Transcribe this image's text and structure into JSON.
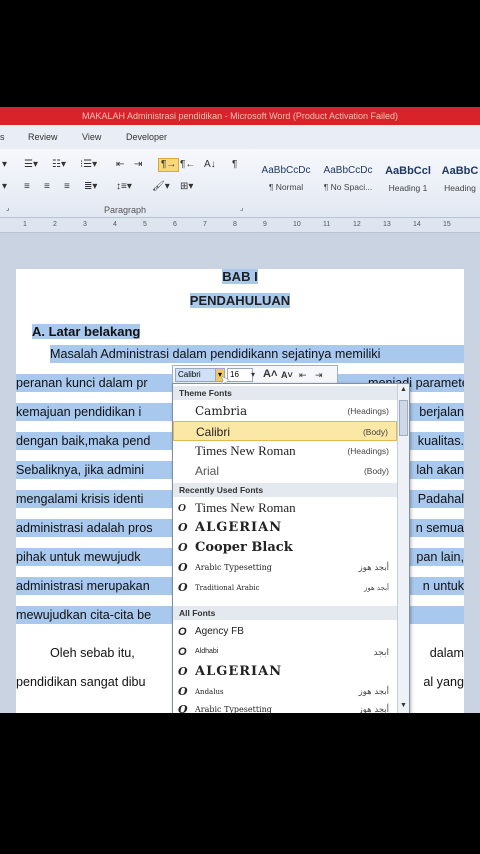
{
  "window": {
    "title": "MAKALAH Administrasi pendidikan - Microsoft Word (Product Activation Failed)"
  },
  "menu": [
    "Review",
    "View",
    "Developer"
  ],
  "ribbon": {
    "paragraph_label": "Paragraph",
    "styles": [
      {
        "preview": "AaBbCcDc",
        "name": "¶ Normal"
      },
      {
        "preview": "AaBbCcDc",
        "name": "¶ No Spaci..."
      },
      {
        "preview": "AaBbCcl",
        "name": "Heading 1"
      },
      {
        "preview": "AaBbC",
        "name": "Heading"
      }
    ]
  },
  "ruler": [
    "1",
    "2",
    "3",
    "4",
    "5",
    "6",
    "7",
    "8",
    "9",
    "10",
    "11",
    "12",
    "13",
    "14",
    "15"
  ],
  "document": {
    "title1": "BAB I",
    "title2": "PENDAHULUAN",
    "heading": "A. Latar belakang",
    "lines": [
      "Masalah  Administrasi  dalam  pendidikann  sejatinya  memiliki",
      "peranan kunci dalam pr",
      "kemajuan  pendidikan  i",
      "dengan baik,maka  pend",
      "Sebaliknya, jika admini",
      "mengalami  krisis  identi",
      "administrasi adalah pros",
      "pihak  untuk  mewujudk",
      "administrasi  merupakan",
      "mewujudkan cita-cita be",
      "Oleh    sebab    itu,",
      "pendidikan  sangat  dibu"
    ],
    "right_fragments": [
      "menjadi parameter",
      "berjalan",
      "kualitas.",
      "lah akan",
      "Padahal",
      "n semua",
      "pan lain,",
      "n  untuk",
      "dalam",
      "al  yang"
    ]
  },
  "mini_toolbar": {
    "font": "Calibri",
    "size": "16",
    "grow": "A",
    "shrink": "A"
  },
  "font_menu": {
    "theme_header": "Theme Fonts",
    "theme_fonts": [
      {
        "name": "Cambria",
        "tag": "(Headings)"
      },
      {
        "name": "Calibri",
        "tag": "(Body)"
      },
      {
        "name": "Times New Roman",
        "tag": "(Headings)"
      },
      {
        "name": "Arial",
        "tag": "(Body)"
      }
    ],
    "recent_header": "Recently Used Fonts",
    "recent_fonts": [
      {
        "name": "Times New Roman",
        "sample": ""
      },
      {
        "name": "ALGERIAN",
        "sample": ""
      },
      {
        "name": "Cooper Black",
        "sample": ""
      },
      {
        "name": "Arabic Typesetting",
        "sample": "أبجد هوز"
      },
      {
        "name": "Traditional Arabic",
        "sample": "أبجد هوز"
      }
    ],
    "all_header": "All Fonts",
    "all_fonts": [
      {
        "name": "Agency FB",
        "sample": ""
      },
      {
        "name": "Aldhabi",
        "sample": "ابجد"
      },
      {
        "name": "ALGERIAN",
        "sample": ""
      },
      {
        "name": "Andalus",
        "sample": "أبجد هوز"
      },
      {
        "name": "Arabic Typesetting",
        "sample": "أبجد هوز"
      }
    ]
  },
  "colors": {
    "title_bar": "#d8232a",
    "selection": "#a9c8ee",
    "hover": "#fbe7a6"
  }
}
